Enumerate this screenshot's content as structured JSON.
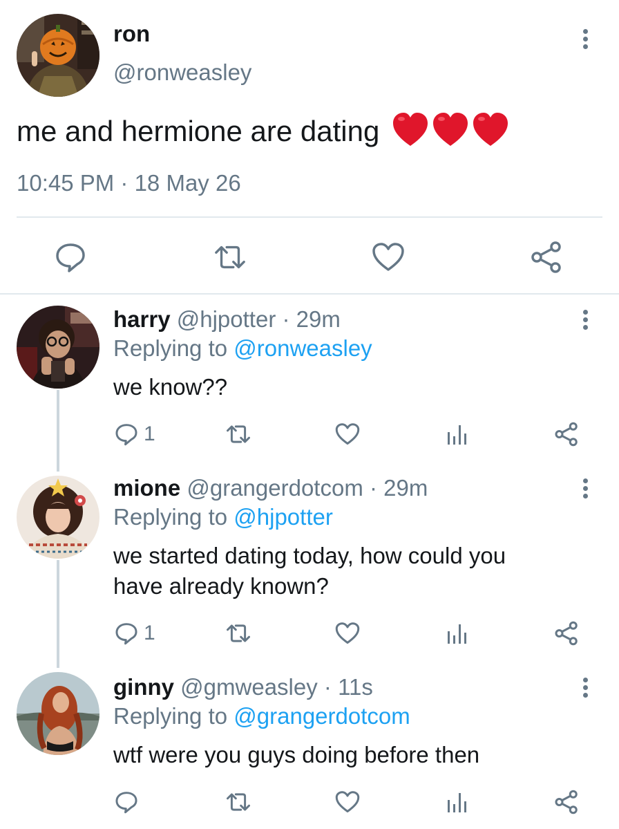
{
  "main_tweet": {
    "name": "ron",
    "handle": "@ronweasley",
    "text": "me and hermione are dating",
    "emoji": "❤️❤️❤️",
    "timestamp": "10:45 PM · 18 May 26",
    "actions": [
      "reply-icon",
      "retweet-icon",
      "like-icon",
      "share-icon"
    ]
  },
  "replies": [
    {
      "name": "harry",
      "handle": "@hjpotter",
      "time": "· 29m",
      "replying_prefix": "Replying to ",
      "replying_to": "@ronweasley",
      "text": "we know??",
      "reply_count": "1"
    },
    {
      "name": "mione",
      "handle": "@grangerdotcom",
      "time": "· 29m",
      "replying_prefix": "Replying to ",
      "replying_to": "@hjpotter",
      "text": "we started dating today, how could you have already known?",
      "reply_count": "1"
    },
    {
      "name": "ginny",
      "handle": "@gmweasley",
      "time": "· 11s",
      "replying_prefix": "Replying to ",
      "replying_to": "@grangerdotcom",
      "text": "wtf were you guys doing before then",
      "reply_count": ""
    }
  ],
  "colors": {
    "text": "#14171a",
    "muted": "#657786",
    "link": "#1da1f2",
    "divider": "#e1e8ed",
    "heart": "#e0162b"
  }
}
